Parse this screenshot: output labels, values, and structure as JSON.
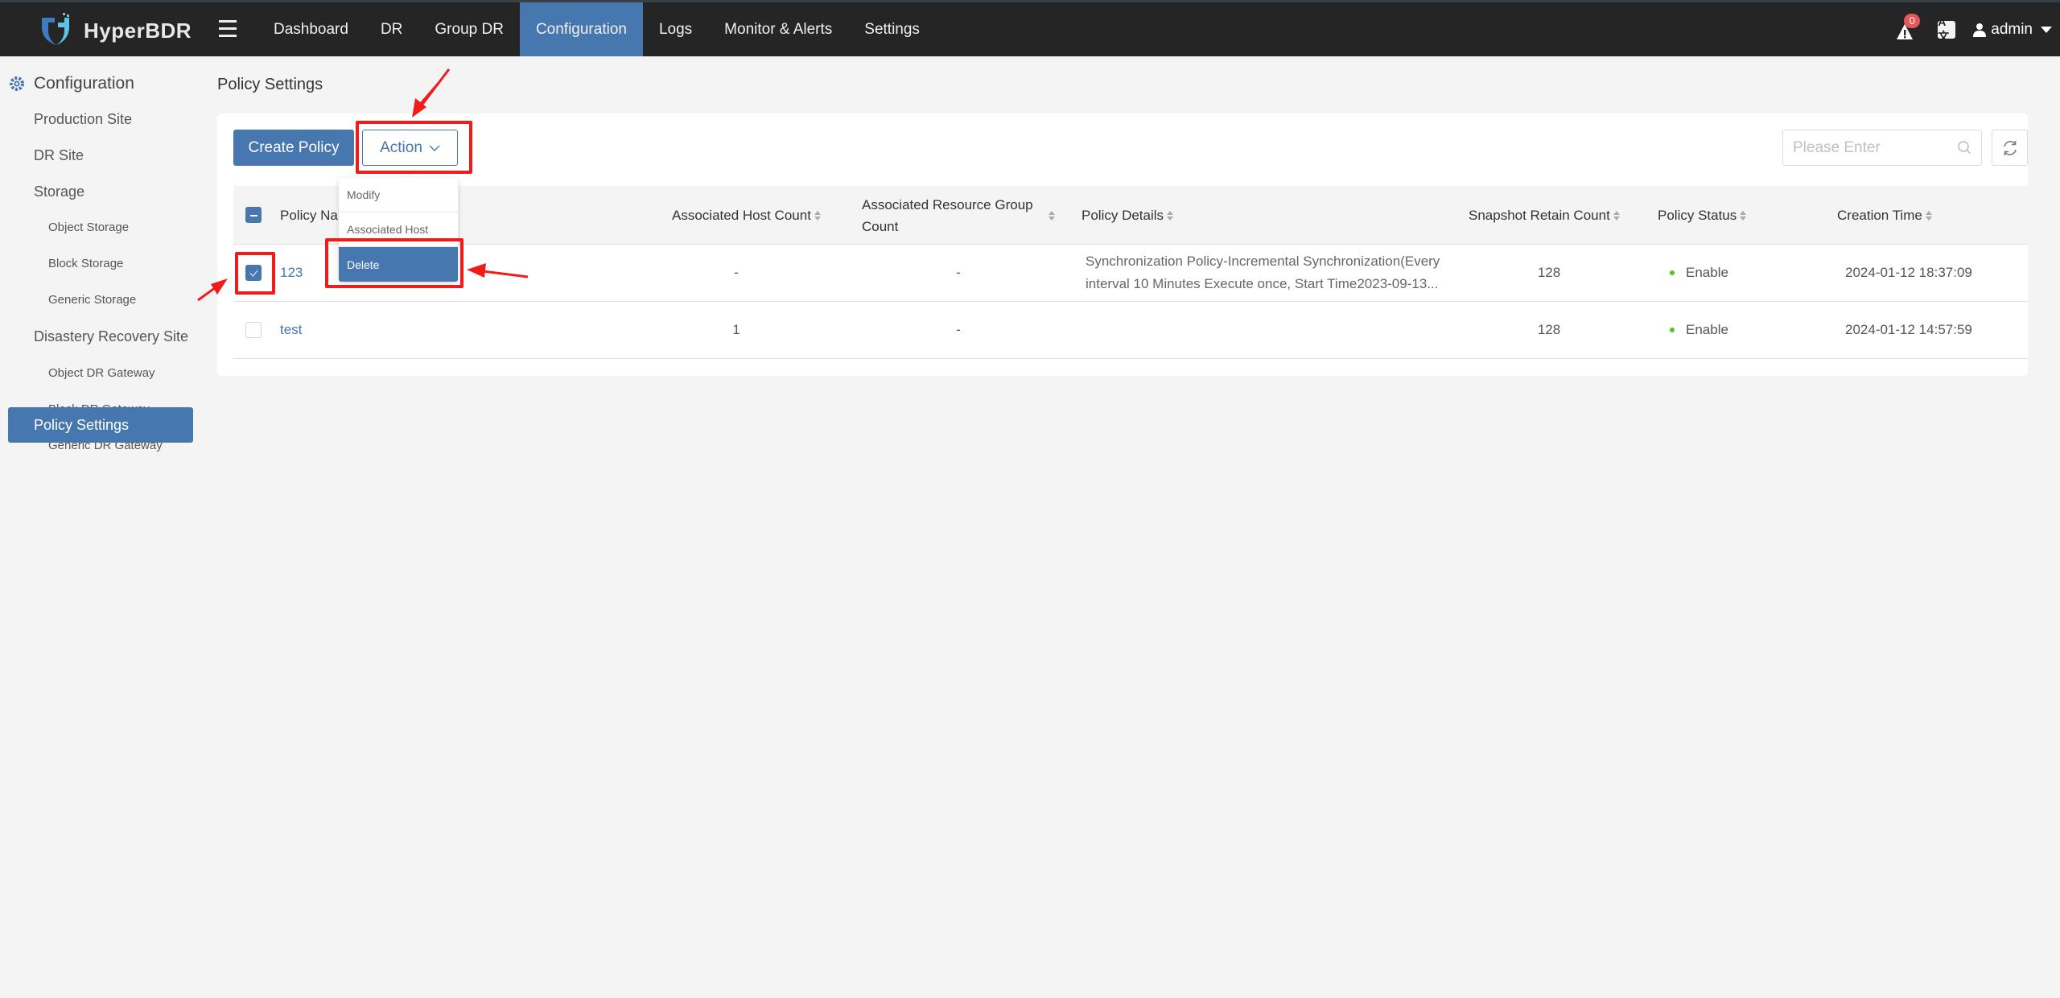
{
  "app": {
    "name": "HyperBDR",
    "nav": [
      {
        "label": "Dashboard",
        "active": false
      },
      {
        "label": "DR",
        "active": false
      },
      {
        "label": "Group DR",
        "active": false
      },
      {
        "label": "Configuration",
        "active": true
      },
      {
        "label": "Logs",
        "active": false
      },
      {
        "label": "Monitor & Alerts",
        "active": false
      },
      {
        "label": "Settings",
        "active": false
      }
    ],
    "alert_count": "0",
    "language_icon": "A文",
    "user": "admin"
  },
  "sidebar": {
    "title": "Configuration",
    "items": [
      {
        "label": "Production Site",
        "level": 1
      },
      {
        "label": "DR Site",
        "level": 1
      },
      {
        "label": "Storage",
        "level": 1
      },
      {
        "label": "Object Storage",
        "level": 2
      },
      {
        "label": "Block Storage",
        "level": 2
      },
      {
        "label": "Generic Storage",
        "level": 2
      },
      {
        "label": "Disastery Recovery Site",
        "level": 1
      },
      {
        "label": "Object DR Gateway",
        "level": 2
      },
      {
        "label": "Block DR Gateway",
        "level": 2
      },
      {
        "label": "Generic DR Gateway",
        "level": 2
      },
      {
        "label": "Policy Settings",
        "level": 1,
        "active": true
      }
    ]
  },
  "page": {
    "title": "Policy Settings",
    "create_button": "Create Policy",
    "action_button": "Action",
    "search_placeholder": "Please Enter",
    "action_menu": [
      "Modify",
      "Associated Host",
      "Delete"
    ],
    "highlighted_menu_item": "Delete"
  },
  "table": {
    "columns": [
      "Policy Name",
      "Associated Host Count",
      "Associated Resource Group Count",
      "Policy Details",
      "Snapshot Retain Count",
      "Policy Status",
      "Creation Time"
    ],
    "header_partial_label": "Policy Na",
    "rows": [
      {
        "checked": true,
        "name": "123",
        "host_count": "-",
        "resource_group_count": "-",
        "details": "Synchronization Policy-Incremental Synchronization(Every interval 10 Minutes Execute once, Start Time2023-09-13...",
        "snapshot_retain": "128",
        "status": "Enable",
        "created": "2024-01-12 18:37:09"
      },
      {
        "checked": false,
        "name": "test",
        "host_count": "1",
        "resource_group_count": "-",
        "details": "",
        "snapshot_retain": "128",
        "status": "Enable",
        "created": "2024-01-12 14:57:59"
      }
    ]
  },
  "colors": {
    "primary": "#4677af",
    "header_bg": "#252525",
    "status_enable": "#52c41a",
    "annotation": "#f01c1c"
  }
}
